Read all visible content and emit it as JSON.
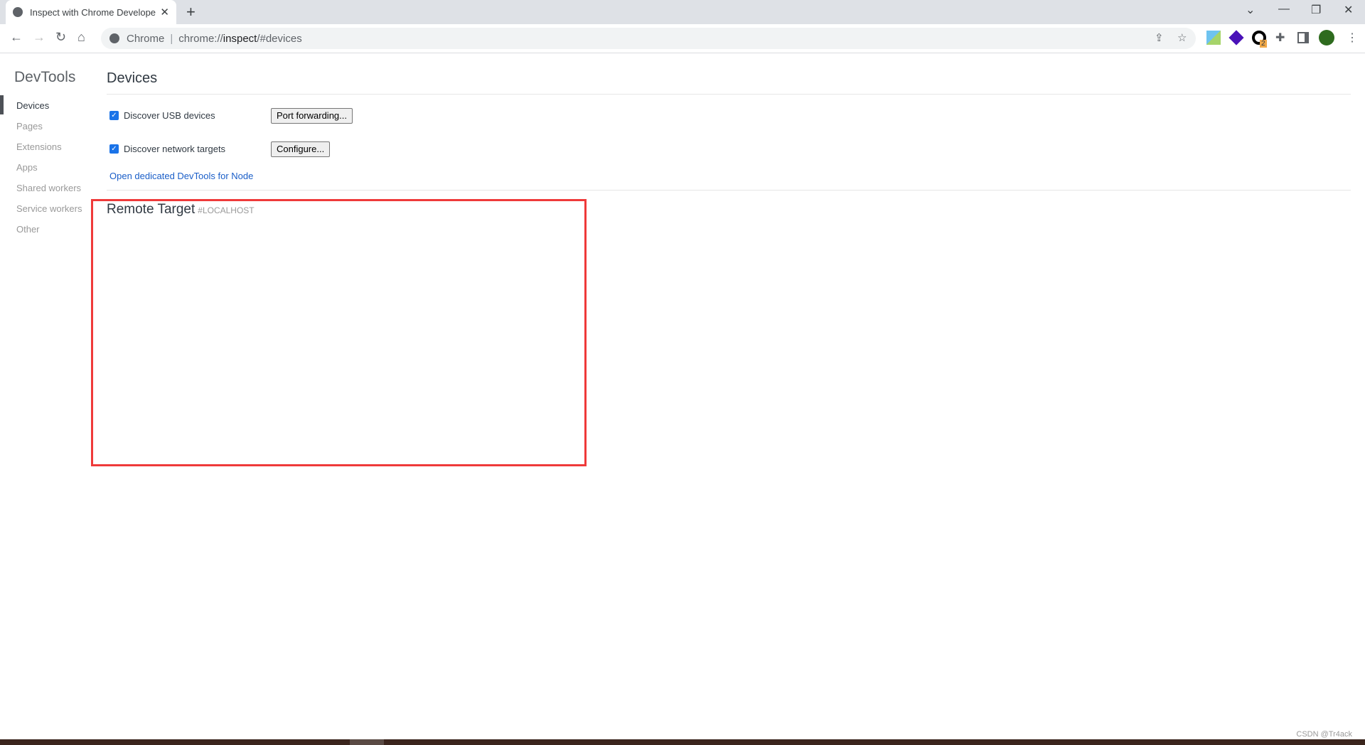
{
  "browser": {
    "tab_title": "Inspect with Chrome Developer Tools",
    "tab_close": "✕",
    "new_tab": "+",
    "omnibox_origin": "Chrome",
    "url_prefix": "chrome://",
    "url_host": "inspect",
    "url_suffix": "/#devices",
    "extension_badge": "2",
    "icons": [
      "back-icon",
      "forward-icon",
      "reload-icon",
      "home-icon",
      "share-icon",
      "star-icon",
      "extension-download-icon",
      "extension-purple-icon",
      "extension-circle-icon",
      "puzzle-icon",
      "side-panel-icon",
      "profile-avatar",
      "menu-icon"
    ]
  },
  "sidebar": {
    "title": "DevTools",
    "items": [
      {
        "label": "Devices",
        "selected": true
      },
      {
        "label": "Pages"
      },
      {
        "label": "Extensions"
      },
      {
        "label": "Apps"
      },
      {
        "label": "Shared workers"
      },
      {
        "label": "Service workers"
      },
      {
        "label": "Other"
      }
    ]
  },
  "main": {
    "title": "Devices",
    "usb": {
      "label": "Discover USB devices",
      "checked": true,
      "button": "Port forwarding..."
    },
    "network": {
      "label": "Discover network targets",
      "checked": true,
      "button": "Configure..."
    },
    "node_link": "Open dedicated DevTools for Node",
    "remote_target": {
      "title": "Remote Target",
      "host": "#LOCALHOST"
    }
  },
  "watermark": "CSDN @Tr4ack",
  "colors": {
    "highlight_box": "#ef3a3a",
    "link": "#1a5ec8",
    "checkbox": "#1a73e8"
  }
}
